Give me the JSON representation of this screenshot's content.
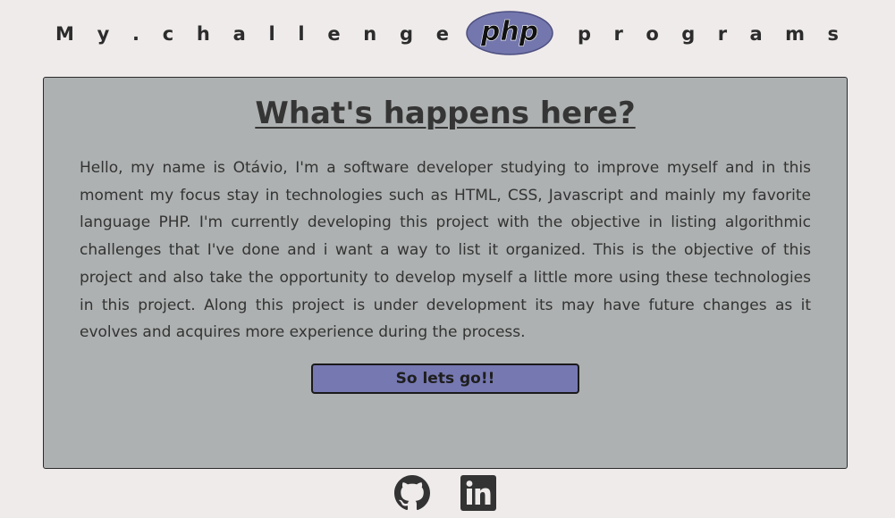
{
  "header": {
    "title_left": "My.challenge",
    "logo_text": "php",
    "title_right": "programs"
  },
  "card": {
    "title": "What's happens here?",
    "text": "Hello, my name is Otávio, I'm a software developer studying to improve myself and in this moment my focus stay in technologies such as HTML, CSS, Javascript and mainly my favorite language PHP. I'm currently developing this project with the objective in listing algorithmic challenges that I've done and i want a way to list it organized. This is the objective of this project and also take the opportunity to develop myself a little more using these technologies in this project. Along this project is under development its may have future changes as it evolves and acquires more experience during the process.",
    "button_label": "So lets go!!"
  },
  "footer": {
    "icons": [
      "github-icon",
      "linkedin-icon"
    ]
  },
  "colors": {
    "background": "#f0ebeb",
    "card": "#aeb1b1",
    "button": "#7678b2",
    "php_logo": "#7377ad"
  }
}
